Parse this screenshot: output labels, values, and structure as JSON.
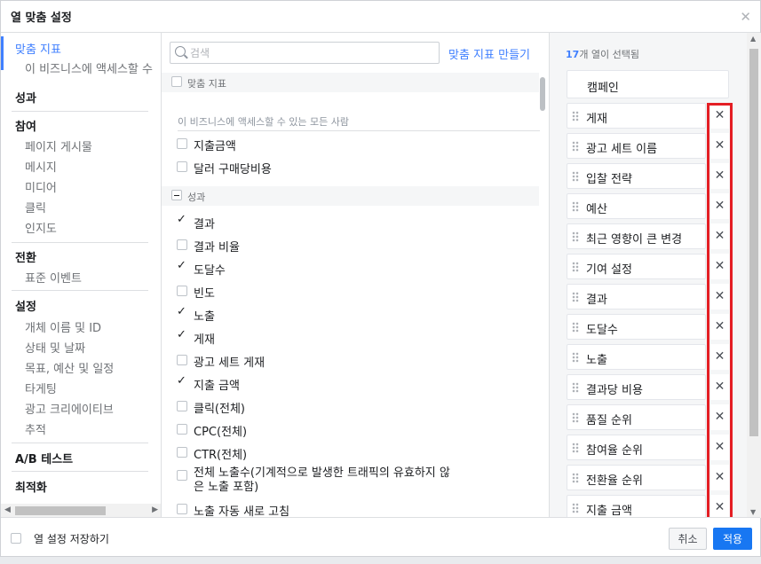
{
  "dialog": {
    "title": "열 맞춤 설정",
    "close_icon": "close-icon"
  },
  "left": {
    "sections": [
      {
        "label": "맞춤 지표",
        "active": true
      },
      {
        "label": "성과"
      },
      {
        "label": "참여"
      },
      {
        "label": "전환"
      },
      {
        "label": "설정"
      },
      {
        "label": "A/B 테스트"
      },
      {
        "label": "최적화"
      }
    ],
    "subitems": {
      "custom": [
        "이 비즈니스에 액세스할 수"
      ],
      "engagement": [
        "페이지 게시물",
        "메시지",
        "미디어",
        "클릭",
        "인지도"
      ],
      "conversion": [
        "표준 이벤트"
      ],
      "settings": [
        "개체 이름 및 ID",
        "상태 및 날짜",
        "목표, 예산 및 일정",
        "타게팅",
        "광고 크리에이티브",
        "추적"
      ]
    }
  },
  "middle": {
    "search_placeholder": "검색",
    "create_link": "맞춤 지표 만들기",
    "group_custom": "맞춤 지표",
    "audience_label": "이 비즈니스에 액세스할 수 있는 모든 사람",
    "custom_items": [
      {
        "label": "지출금액",
        "checked": false
      },
      {
        "label": "달러 구매당비용",
        "checked": false
      }
    ],
    "group_performance": "성과",
    "performance_items": [
      {
        "label": "결과",
        "checked": true
      },
      {
        "label": "결과 비율",
        "checked": false
      },
      {
        "label": "도달수",
        "checked": true
      },
      {
        "label": "빈도",
        "checked": false
      },
      {
        "label": "노출",
        "checked": true
      },
      {
        "label": "게재",
        "checked": true
      },
      {
        "label": "광고 세트 게재",
        "checked": false
      },
      {
        "label": "지출 금액",
        "checked": true
      },
      {
        "label": "클릭(전체)",
        "checked": false
      },
      {
        "label": "CPC(전체)",
        "checked": false
      },
      {
        "label": "CTR(전체)",
        "checked": false
      },
      {
        "label": "전체 노출수(기계적으로 발생한 트래픽의 유효하지 않은 노출 포함)",
        "checked": false
      },
      {
        "label": "노출 자동 새로 고침",
        "checked": false
      }
    ]
  },
  "right": {
    "count_number": "17",
    "count_text": "개 열이 선택됨",
    "fixed_column": "캠페인",
    "columns": [
      "게재",
      "광고 세트 이름",
      "입찰 전략",
      "예산",
      "최근 영향이 큰 변경",
      "기여 설정",
      "결과",
      "도달수",
      "노출",
      "결과당 비용",
      "품질 순위",
      "참여율 순위",
      "전환율 순위",
      "지출 금액"
    ],
    "remove_glyph": "✕"
  },
  "footer": {
    "save_label": "열 설정 저장하기",
    "cancel_label": "취소",
    "apply_label": "적용"
  },
  "colors": {
    "accent": "#4080ff",
    "apply": "#1877f2",
    "highlight": "#e41e24"
  }
}
